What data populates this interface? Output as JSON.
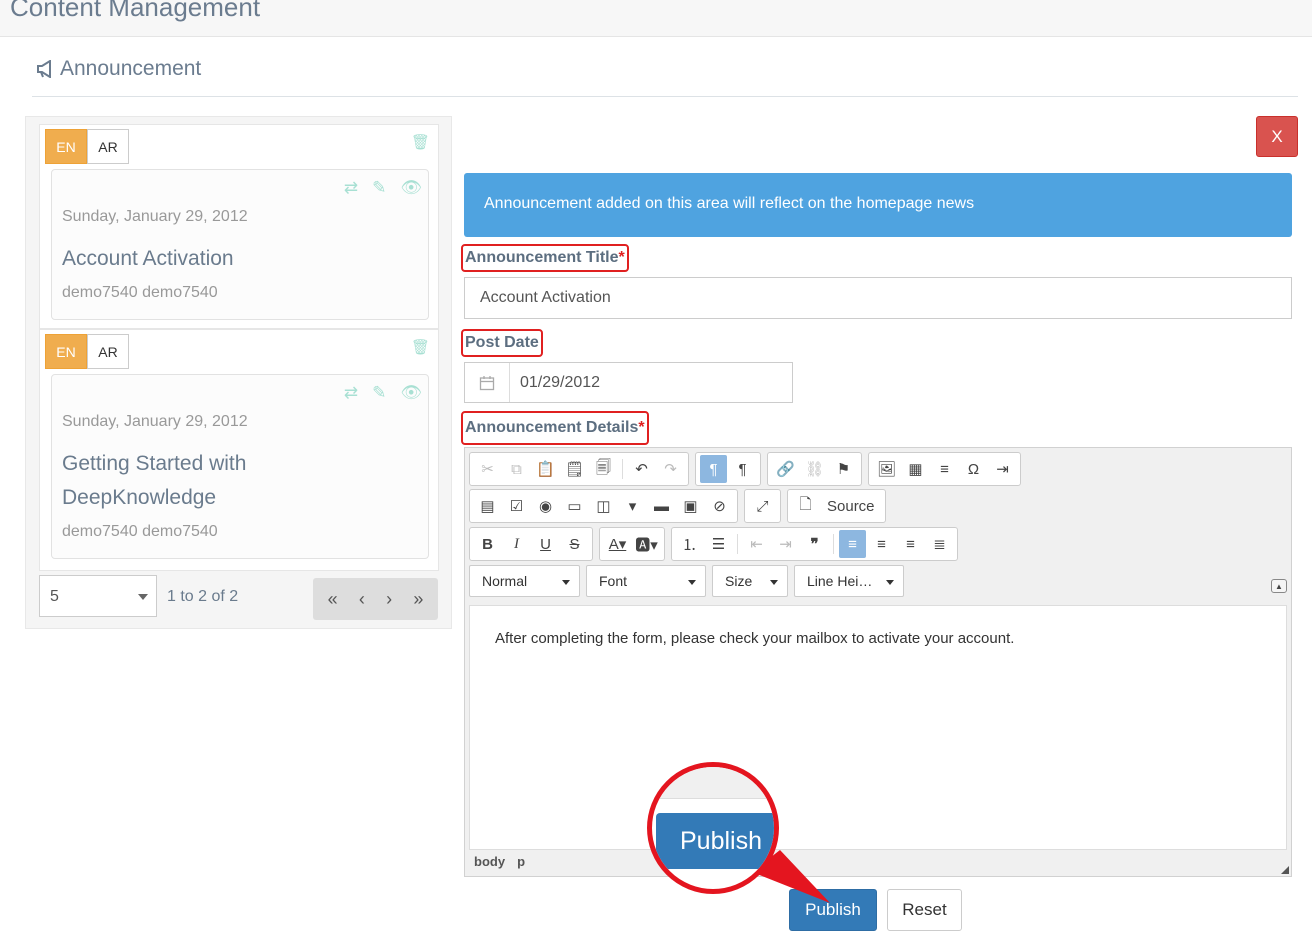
{
  "page": {
    "title": "Content Management"
  },
  "section": {
    "title": "Announcement"
  },
  "list": {
    "items": [
      {
        "lang_en": "EN",
        "lang_ar": "AR",
        "date": "Sunday, January 29, 2012",
        "title": "Account Activation",
        "author": "demo7540 demo7540"
      },
      {
        "lang_en": "EN",
        "lang_ar": "AR",
        "date": "Sunday, January 29, 2012",
        "title": "Getting Started with DeepKnowledge",
        "author": "demo7540 demo7540"
      }
    ],
    "page_size": "5",
    "range_info": "1 to 2 of 2",
    "nav": {
      "first": "«",
      "prev": "‹",
      "next": "›",
      "last": "»"
    }
  },
  "form": {
    "close_label": "X",
    "info": "Announcement added on this area will reflect on the homepage news",
    "title_label": "Announcement Title",
    "title_value": "Account Activation",
    "date_label": "Post Date",
    "date_value": "01/29/2012",
    "details_label": "Announcement Details",
    "required_mark": "*",
    "editor": {
      "source_label": "Source",
      "format": "Normal",
      "font": "Font",
      "size": "Size",
      "line_height": "Line Hei…",
      "content": "After completing the form, please check your mailbox to activate your account.",
      "path_body": "body",
      "path_p": "p"
    },
    "publish_label": "Publish",
    "reset_label": "Reset"
  },
  "callout": {
    "label": "Publish"
  },
  "colors": {
    "accent": "#337ab7",
    "info": "#4fa3e0",
    "danger": "#d9534f",
    "warning": "#f0ad4e",
    "highlight": "#e4151f"
  }
}
